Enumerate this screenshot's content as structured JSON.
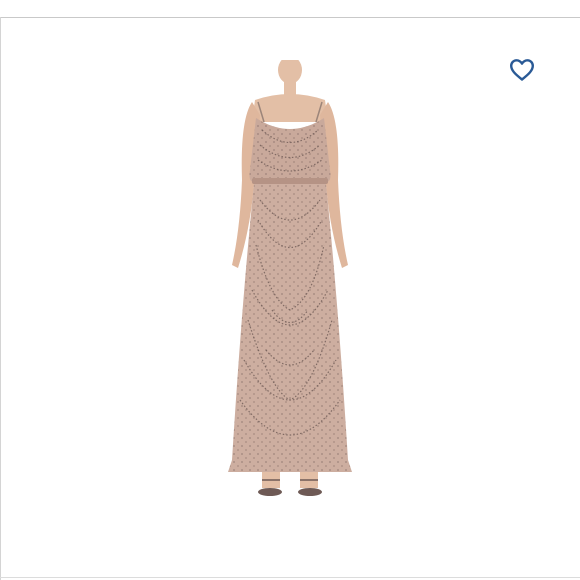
{
  "listing": {
    "image_subject": "beaded-blouson-maxi-dress",
    "like_icon": "heart-outline-icon"
  },
  "colors": {
    "accent": "#2a5a96",
    "dress": "#c9a99b",
    "bead": "#6e5a55",
    "skin": "#e3bfa6"
  }
}
